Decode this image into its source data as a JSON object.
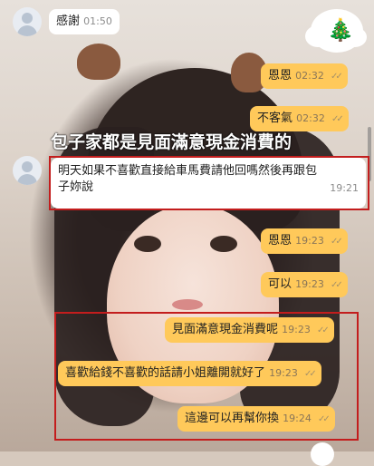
{
  "caption": "包子家都是見面滿意現金消費的",
  "sticker_icon": "christmas-tree-icon",
  "messages": [
    {
      "text": "感謝",
      "time": "01:50"
    },
    {
      "text": "恩恩",
      "time": "02:32"
    },
    {
      "text": "不客氣",
      "time": "02:32"
    },
    {
      "text": "明天如果不喜歡直接給車馬費請他回嗎然後再跟包",
      "text2": "子妳說",
      "time": "19:21"
    },
    {
      "text": "恩恩",
      "time": "19:23"
    },
    {
      "text": "可以",
      "time": "19:23"
    },
    {
      "text": "見面滿意現金消費呢",
      "time": "19:23"
    },
    {
      "text": "喜歡給錢不喜歡的話請小姐離開就好了",
      "time": "19:23"
    },
    {
      "text": "這邊可以再幫你換",
      "time": "19:24"
    }
  ],
  "colors": {
    "outgoing": "#ffc95a",
    "incoming": "#ffffff",
    "highlight": "#c31d1d"
  }
}
